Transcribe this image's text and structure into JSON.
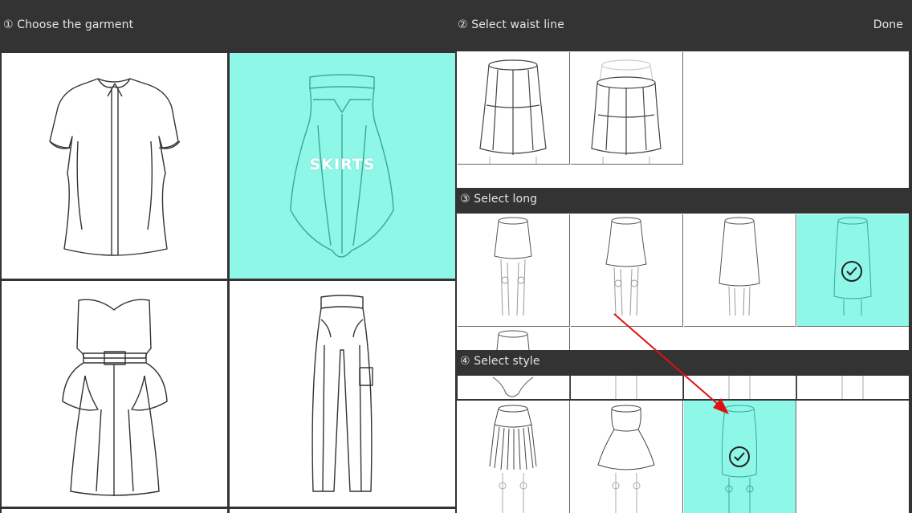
{
  "header": {
    "step1": "① Choose the garment",
    "step2": "② Select waist line",
    "done": "Done"
  },
  "garments": {
    "items": [
      {
        "name": "blouse",
        "selected": false
      },
      {
        "name": "skirts",
        "label": "SKIRTS",
        "selected": true
      },
      {
        "name": "dress",
        "selected": false
      },
      {
        "name": "pants",
        "selected": false
      }
    ]
  },
  "waist": {
    "options": [
      {
        "name": "waist-high",
        "selected": false
      },
      {
        "name": "waist-low",
        "selected": false
      }
    ]
  },
  "long": {
    "title": "③ Select long",
    "options": [
      {
        "name": "mini",
        "selected": false
      },
      {
        "name": "above-knee",
        "selected": false
      },
      {
        "name": "knee",
        "selected": false
      },
      {
        "name": "maxi",
        "selected": true
      }
    ]
  },
  "style": {
    "title": "④ Select style",
    "options": [
      {
        "name": "fringe",
        "selected": false
      },
      {
        "name": "a-line",
        "selected": false
      },
      {
        "name": "pencil",
        "selected": true
      }
    ]
  },
  "colors": {
    "background": "#333333",
    "selected": "#8ef7e8",
    "annotation_arrow": "#e01010"
  }
}
